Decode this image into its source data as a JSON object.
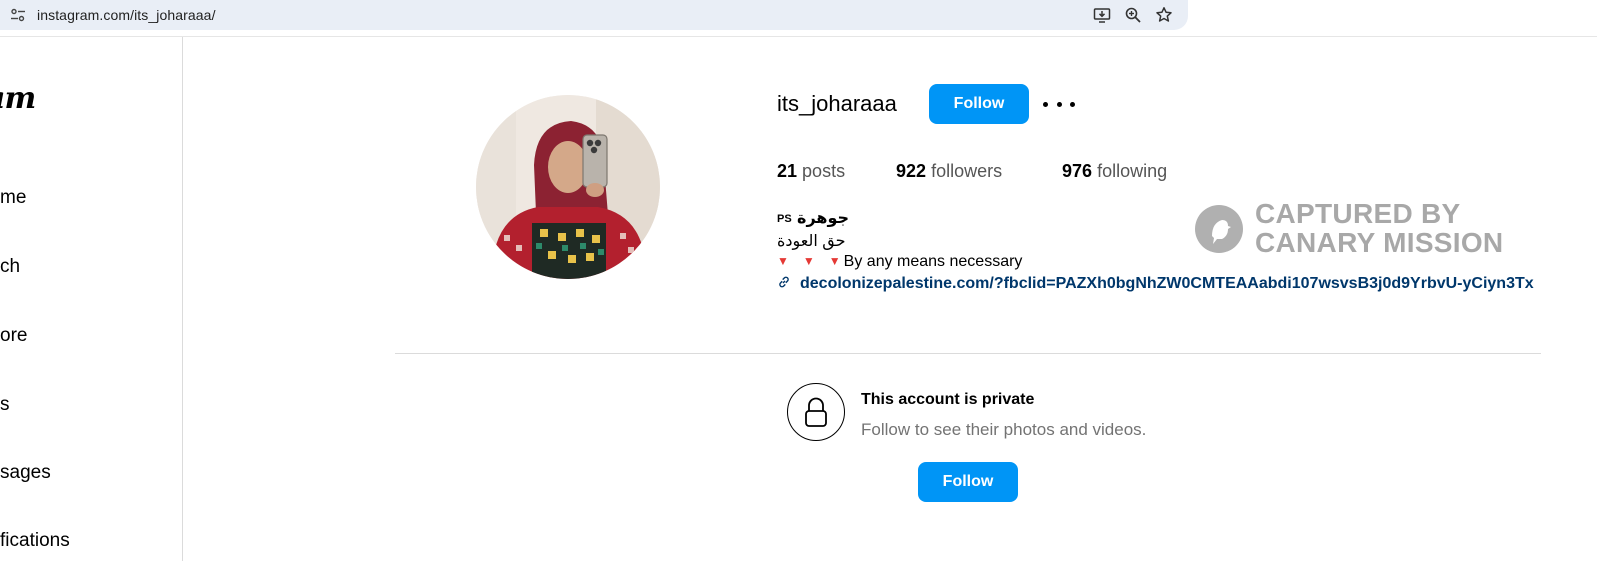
{
  "browser": {
    "url": "instagram.com/its_joharaaa/",
    "icons": [
      "tune-icon",
      "install-app-icon",
      "zoom-icon",
      "bookmark-star-icon"
    ]
  },
  "sidebar": {
    "logo": "am",
    "items": [
      {
        "label": "me",
        "icon": "home"
      },
      {
        "label": "ch",
        "icon": "search"
      },
      {
        "label": "ore",
        "icon": "explore"
      },
      {
        "label": "s",
        "icon": "reels"
      },
      {
        "label": "sages",
        "icon": "messages"
      },
      {
        "label": "fications",
        "icon": "notifications"
      }
    ]
  },
  "profile": {
    "username": "its_joharaaa",
    "follow_label": "Follow",
    "stats": {
      "posts_count": "21",
      "posts_label": "posts",
      "followers_count": "922",
      "followers_label": "followers",
      "following_count": "976",
      "following_label": "following"
    },
    "bio": {
      "name": "جوهرة",
      "name_badge": "PS",
      "line2": "حق العودة",
      "triangles": [
        "▼",
        "▼",
        "▼"
      ],
      "line3": "By any means necessary",
      "link": "decolonizepalestine.com/?fbclid=PAZXh0bgNhZW0CMTEAAabdi107wsvsB3j0d9YrbvU-yCiyn3Tx"
    }
  },
  "watermark": {
    "line1": "CAPTURED BY",
    "line2": "CANARY MISSION"
  },
  "private_notice": {
    "title": "This account is private",
    "subtitle": "Follow to see their photos and videos.",
    "follow_label": "Follow"
  },
  "colors": {
    "accent": "#0095f6",
    "link": "#00376b",
    "muted_text": "#737373",
    "triangle_red": "#e53935"
  }
}
